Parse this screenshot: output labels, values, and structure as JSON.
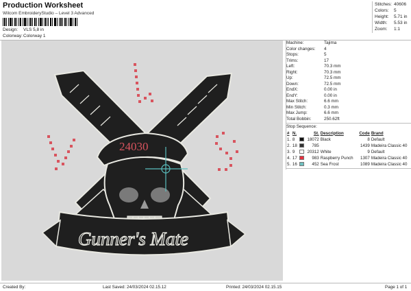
{
  "header": {
    "title": "Production Worksheet",
    "subtitle": "Wilcom EmbroideryStudio – Level 3 Advanced",
    "design_label": "Design:",
    "design_value": "VLS 5,8 in",
    "colorway_label": "Colorway:",
    "colorway_value": "Colorway 1"
  },
  "stats": [
    {
      "label": "Stitches:",
      "value": "40606"
    },
    {
      "label": "Colors:",
      "value": "5"
    },
    {
      "label": "Height:",
      "value": "5.71 in"
    },
    {
      "label": "Width:",
      "value": "5.53 in"
    },
    {
      "label": "Zoom:",
      "value": "1:1"
    }
  ],
  "design": {
    "number_text": "24030",
    "banner_text": "Gunner's Mate",
    "colors": {
      "background": "#d9d9d9",
      "fill": "#1f1f1f",
      "outline": "#e9e9e2",
      "red": "#d8545e",
      "cross": "#5bbfbf"
    }
  },
  "machine_info": [
    {
      "label": "Machine:",
      "value": "Tajima"
    },
    {
      "label": "Color changes:",
      "value": "4"
    },
    {
      "label": "Stops:",
      "value": "5"
    },
    {
      "label": "Trims:",
      "value": "17"
    },
    {
      "label": "Left:",
      "value": "70.3 mm"
    },
    {
      "label": "Right:",
      "value": "70.3 mm"
    },
    {
      "label": "Up:",
      "value": "72.5 mm"
    },
    {
      "label": "Down:",
      "value": "72.5 mm"
    },
    {
      "label": "EndX:",
      "value": "0.00 in"
    },
    {
      "label": "EndY:",
      "value": "0.00 in"
    },
    {
      "label": "Max Stitch:",
      "value": "6.6 mm"
    },
    {
      "label": "Min Stitch:",
      "value": "0.3 mm"
    },
    {
      "label": "Max Jump:",
      "value": "6.6 mm"
    },
    {
      "label": "Total Bobbin:",
      "value": "250.62ft"
    }
  ],
  "stop_sequence": {
    "title": "Stop Sequence:",
    "columns": {
      "idx": "#",
      "n": "N.",
      "st": "St.",
      "desc": "Description",
      "code": "Code",
      "brand": "Brand"
    },
    "rows": [
      {
        "idx": "1.",
        "n": "8",
        "swatch": "#111111",
        "st": "18072",
        "desc": "Black",
        "code": "8",
        "brand": "Default"
      },
      {
        "idx": "2.",
        "n": "18",
        "swatch": "#333333",
        "st": "785",
        "desc": "",
        "code": "1439",
        "brand": "Madeira Classic 40"
      },
      {
        "idx": "3.",
        "n": "9",
        "swatch": "#ffffff",
        "st": "20312",
        "desc": "White",
        "code": "9",
        "brand": "Default"
      },
      {
        "idx": "4.",
        "n": "17",
        "swatch": "#e8303f",
        "st": "983",
        "desc": "Raspberry Punch",
        "code": "1307",
        "brand": "Madeira Classic 40"
      },
      {
        "idx": "5.",
        "n": "16",
        "swatch": "#6fc0c0",
        "st": "452",
        "desc": "Sea Frost",
        "code": "1089",
        "brand": "Madeira Classic 40"
      }
    ]
  },
  "footer": {
    "created": "Created By:",
    "saved": "Last Saved: 24/03/2024 02.15.12",
    "printed": "Printed: 24/03/2024 02.15.15",
    "page": "Page 1 of 1"
  }
}
